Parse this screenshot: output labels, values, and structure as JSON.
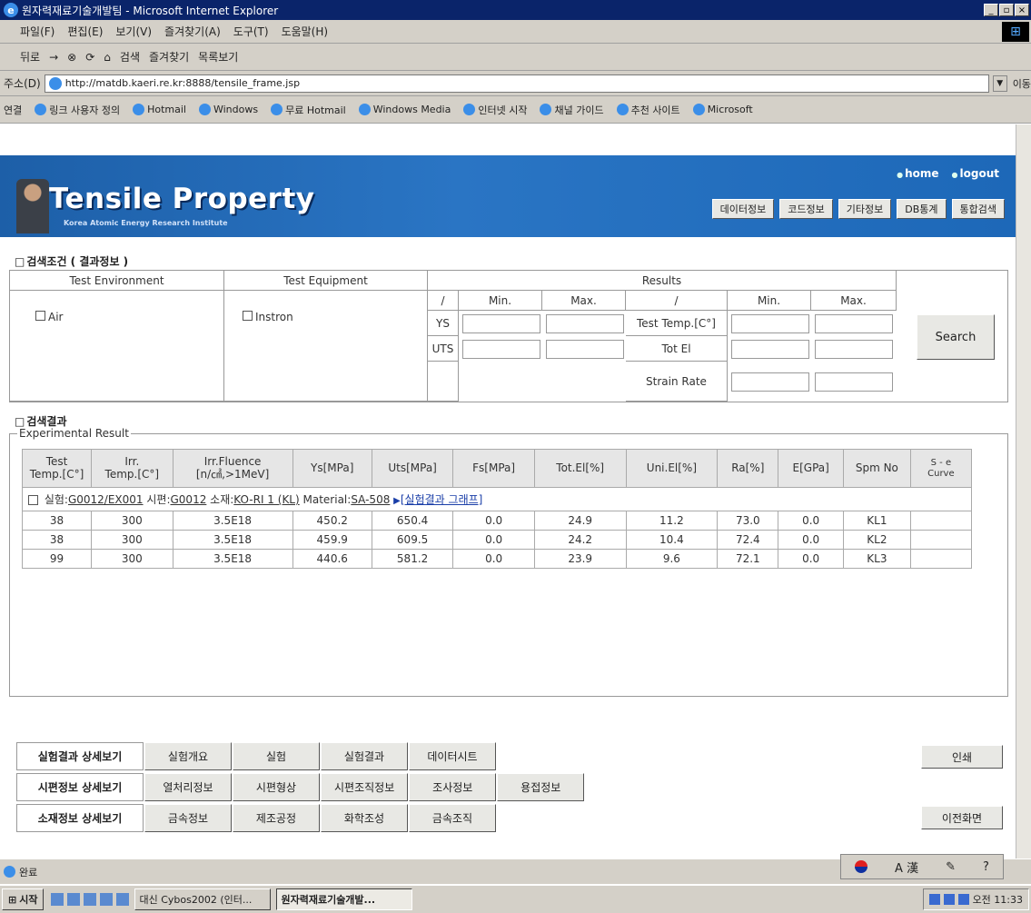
{
  "window": {
    "title": "원자력재료기술개발팀 - Microsoft Internet Explorer",
    "min": "_",
    "max": "▫",
    "close": "×"
  },
  "menu": [
    "파일(F)",
    "편집(E)",
    "보기(V)",
    "즐겨찾기(A)",
    "도구(T)",
    "도움말(H)"
  ],
  "toolbar": [
    "뒤로",
    "→",
    "⊗",
    "⟳",
    "⌂",
    "검색",
    "즐겨찾기",
    "목록보기"
  ],
  "address": {
    "label": "주소(D)",
    "url": "http://matdb.kaeri.re.kr:8888/tensile_frame.jsp",
    "go": "이동"
  },
  "links": {
    "label": "연결",
    "items": [
      "링크 사용자 정의",
      "Hotmail",
      "Windows",
      "무료 Hotmail",
      "Windows Media",
      "인터넷 시작",
      "채널 가이드",
      "추천 사이트",
      "Microsoft"
    ]
  },
  "banner": {
    "title": "Tensile Property",
    "subtitle": "Korea Atomic Energy Research Institute",
    "home": "home",
    "logout": "logout",
    "nav": [
      "데이터정보",
      "코드정보",
      "기타정보",
      "DB통계",
      "통합검색"
    ]
  },
  "search": {
    "heading": "검색조건 ( 결과정보 )",
    "col_env": "Test Environment",
    "col_equip": "Test Equipment",
    "col_results": "Results",
    "env_option": "Air",
    "equip_option": "Instron",
    "slash": "/",
    "min": "Min.",
    "max": "Max.",
    "rows_left": [
      "YS",
      "UTS"
    ],
    "rows_right": [
      "Test Temp.[C°]",
      "Tot El",
      "Strain Rate"
    ],
    "button": "Search"
  },
  "results": {
    "heading": "검색결과",
    "legend": "Experimental Result",
    "headers": [
      [
        "Test",
        "Temp.[C°]"
      ],
      [
        "Irr.",
        "Temp.[C°]"
      ],
      [
        "Irr.Fluence",
        "[n/㎠,>1MeV]"
      ],
      [
        "Ys[MPa]"
      ],
      [
        "Uts[MPa]"
      ],
      [
        "Fs[MPa]"
      ],
      [
        "Tot.El[%]"
      ],
      [
        "Uni.El[%]"
      ],
      [
        "Ra[%]"
      ],
      [
        "E[GPa]"
      ],
      [
        "Spm No"
      ],
      [
        "S - e",
        "Curve"
      ]
    ],
    "experiment": {
      "exp_label": "실험:",
      "exp_value": "G0012/EX001",
      "spec_label": "시편:",
      "spec_value": "G0012",
      "mat_label": "소재:",
      "mat_value": "KO-RI 1 (KL)",
      "material_label": "Material:",
      "material_value": "SA-508",
      "graph_link": "[실험결과 그래프]"
    },
    "rows": [
      [
        "38",
        "300",
        "3.5E18",
        "450.2",
        "650.4",
        "0.0",
        "24.9",
        "11.2",
        "73.0",
        "0.0",
        "KL1",
        ""
      ],
      [
        "38",
        "300",
        "3.5E18",
        "459.9",
        "609.5",
        "0.0",
        "24.2",
        "10.4",
        "72.4",
        "0.0",
        "KL2",
        ""
      ],
      [
        "99",
        "300",
        "3.5E18",
        "440.6",
        "581.2",
        "0.0",
        "23.9",
        "9.6",
        "72.1",
        "0.0",
        "KL3",
        ""
      ]
    ]
  },
  "details": [
    {
      "label": "실험결과 상세보기",
      "buttons": [
        "실험개요",
        "실험",
        "실험결과",
        "데이터시트"
      ]
    },
    {
      "label": "시편정보 상세보기",
      "buttons": [
        "열처리정보",
        "시편형상",
        "시편조직정보",
        "조사정보",
        "용접정보"
      ]
    },
    {
      "label": "소재정보 상세보기",
      "buttons": [
        "금속정보",
        "제조공정",
        "화학조성",
        "금속조직"
      ]
    }
  ],
  "print_button": "인쇄",
  "back_button": "이전화면",
  "status": {
    "text": "완료",
    "ime": "A 漢"
  },
  "taskbar": {
    "start": "시작",
    "tasks": [
      "대신 Cybos2002 (인터...",
      "원자력재료기술개발..."
    ],
    "clock": "오전 11:33"
  }
}
